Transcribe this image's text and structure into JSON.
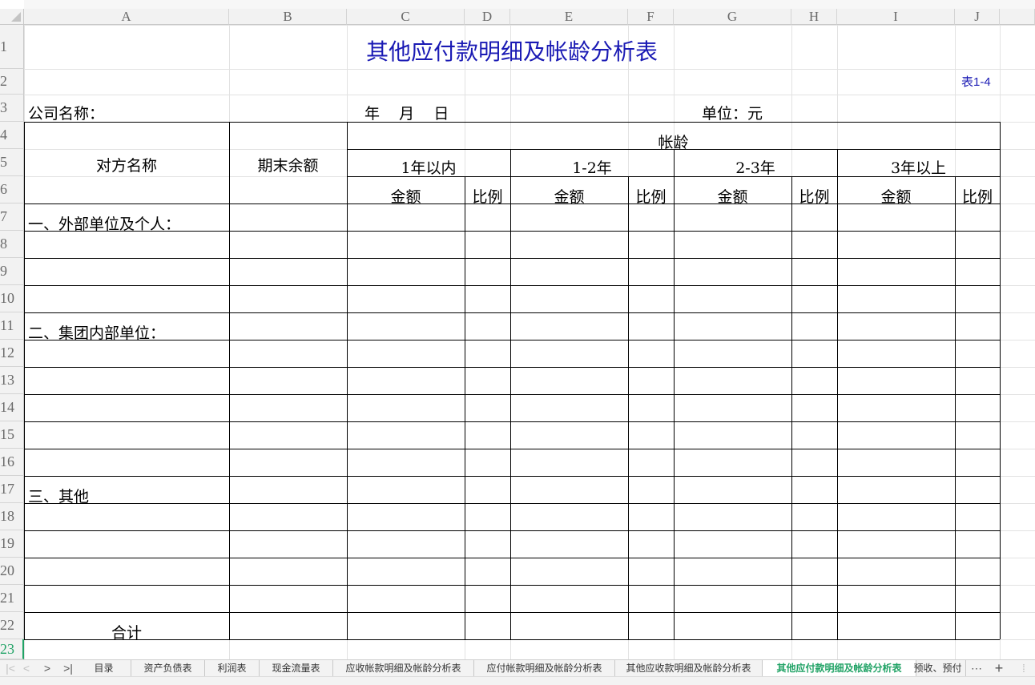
{
  "columns": [
    "A",
    "B",
    "C",
    "D",
    "E",
    "F",
    "G",
    "H",
    "I",
    "J"
  ],
  "rows": [
    "1",
    "2",
    "3",
    "4",
    "5",
    "6",
    "7",
    "8",
    "9",
    "10",
    "11",
    "12",
    "13",
    "14",
    "15",
    "16",
    "17",
    "18",
    "19",
    "20",
    "21",
    "22",
    "23"
  ],
  "report": {
    "title": "其他应付款明细及帐龄分析表",
    "table_no": "表1-4",
    "company_label": "公司名称：",
    "date_label": "年    月    日",
    "unit_label": "单位：元",
    "header_counterparty": "对方名称",
    "header_balance": "期末余额",
    "header_aging": "帐龄",
    "aging_groups": [
      "1年以内",
      "1-2年",
      "2-3年",
      "3年以上"
    ],
    "sub_amount": "金额",
    "sub_ratio": "比例",
    "section_external": "一、外部单位及个人：",
    "section_internal": "二、集团内部单位：",
    "section_other": "三、其他",
    "total_label": "合计"
  },
  "tabs": {
    "nav_first": "|<",
    "nav_prev": "<",
    "nav_next": ">",
    "nav_last": ">|",
    "items": [
      "目录",
      "资产负债表",
      "利润表",
      "现金流量表",
      "应收帐款明细及帐龄分析表",
      "应付帐款明细及帐龄分析表",
      "其他应收款明细及帐龄分析表",
      "其他应付款明细及帐龄分析表",
      "预收、预付"
    ],
    "active": "其他应付款明细及帐龄分析表",
    "more": "⋯",
    "add": "+"
  },
  "colors": {
    "title": "#1a1ab4",
    "active_tab": "#21a366",
    "table_no": "#1a1ab4"
  }
}
